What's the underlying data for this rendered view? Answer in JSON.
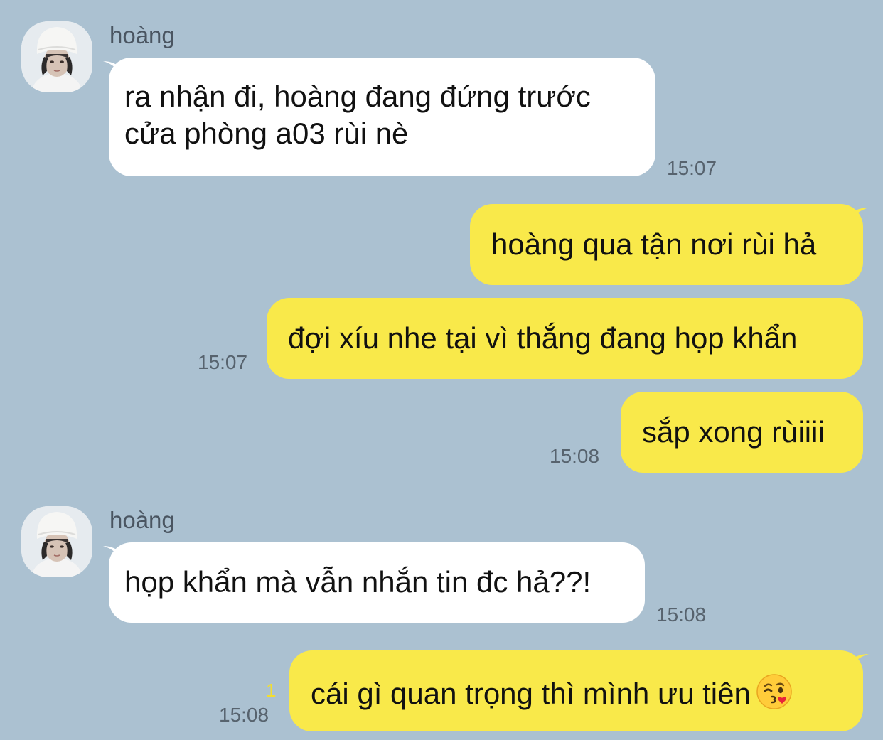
{
  "contact": {
    "name": "hoàng"
  },
  "messages": [
    {
      "from": "them",
      "lines": [
        "ra nhận đi, hoàng đang đứng trước",
        "cửa phòng a03 rùi nè"
      ],
      "time": "15:07"
    },
    {
      "from": "me",
      "text": "hoàng qua tận nơi rùi hả"
    },
    {
      "from": "me",
      "text": "đợi xíu nhe tại vì thắng đang họp khẩn",
      "time": "15:07"
    },
    {
      "from": "me",
      "text": "sắp xong rùiiii",
      "time": "15:08"
    },
    {
      "from": "them",
      "text": "họp khẩn mà vẫn nhắn tin đc hả??!",
      "time": "15:08"
    },
    {
      "from": "me",
      "text": "cái gì quan trọng thì mình ưu tiên",
      "emoji": "kiss-wink-emoji",
      "time": "15:08",
      "unread_count": "1"
    }
  ],
  "colors": {
    "background": "#abc1d1",
    "incoming_bubble": "#ffffff",
    "outgoing_bubble": "#f9e94a",
    "unread_badge": "#f3de2f",
    "timestamp": "#57636e"
  }
}
